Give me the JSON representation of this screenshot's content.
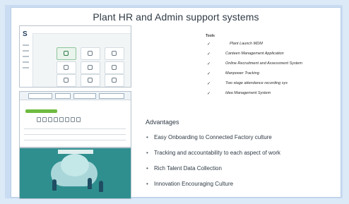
{
  "slide": {
    "title": "Plant HR and Admin support systems"
  },
  "tools": {
    "header": "Tools",
    "items": [
      "Plant Launch MDM",
      "Canteen Management Application",
      "Online Recruitment and Assessment System",
      "Manpower Tracking",
      "Two stage attendance recording sys",
      "Idea Management System"
    ]
  },
  "advantages": {
    "title": "Advantages",
    "items": [
      "Easy Onboarding to Connected Factory culture",
      "Tracking and accountability to each aspect of work",
      "Rich Talent Data Collection",
      "Innovation Encouraging Culture"
    ]
  },
  "screenshots": {
    "dashboard_logo": "S",
    "icons": [
      "check-icon",
      "bullet-dot"
    ]
  },
  "colors": {
    "accent_green": "#6dbb3f",
    "teal": "#2f8f8f",
    "background": "#dce9f7"
  }
}
